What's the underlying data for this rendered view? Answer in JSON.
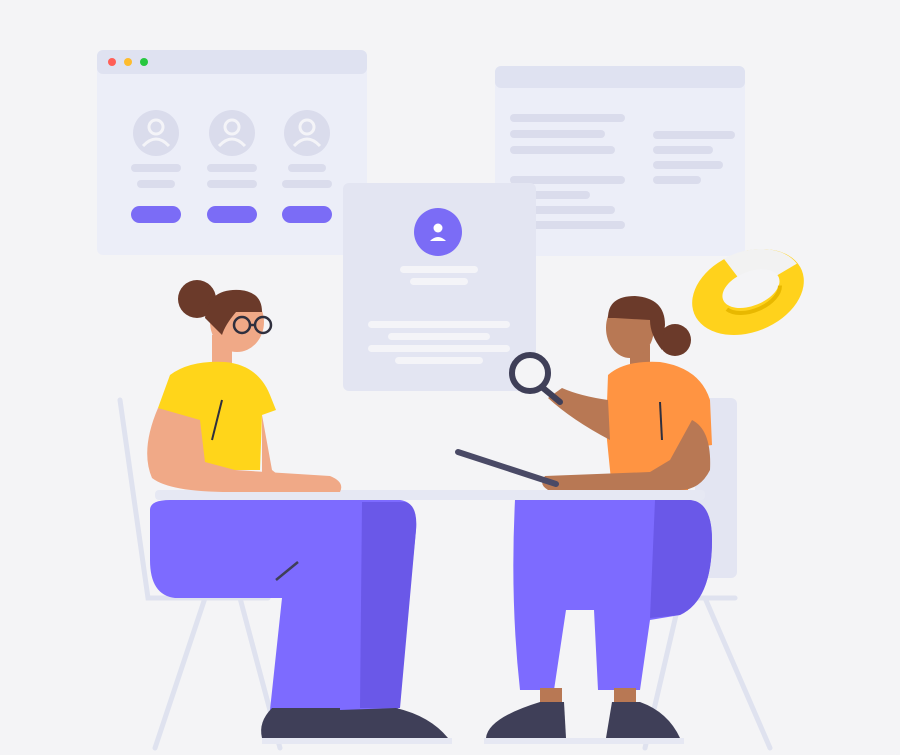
{
  "scene": {
    "description_icons": [
      "window-controls",
      "user-avatar-icon",
      "magnifier-icon",
      "tablet-icon",
      "lifebuoy-icon"
    ]
  },
  "colors": {
    "background": "#f4f4f6",
    "panel": "#eceef8",
    "panel_header": "#dfe2f1",
    "placeholder_bar": "#dadcec",
    "accent_purple": "#7b6cf6",
    "pants_purple": "#7d6bff",
    "pants_shadow": "#6a58e8",
    "shirt_yellow": "#ffd51a",
    "shirt_orange": "#ff9442",
    "skin_light": "#f0a987",
    "skin_dark": "#b87854",
    "hair": "#6b3a2a",
    "shoe": "#3f3f58",
    "chair": "#dfe2ef",
    "lifebuoy_yellow": "#ffd21c",
    "lifebuoy_white": "#f2f2f2",
    "dot_red": "#ff5f57",
    "dot_yellow": "#febc2e",
    "dot_green": "#28c840"
  }
}
